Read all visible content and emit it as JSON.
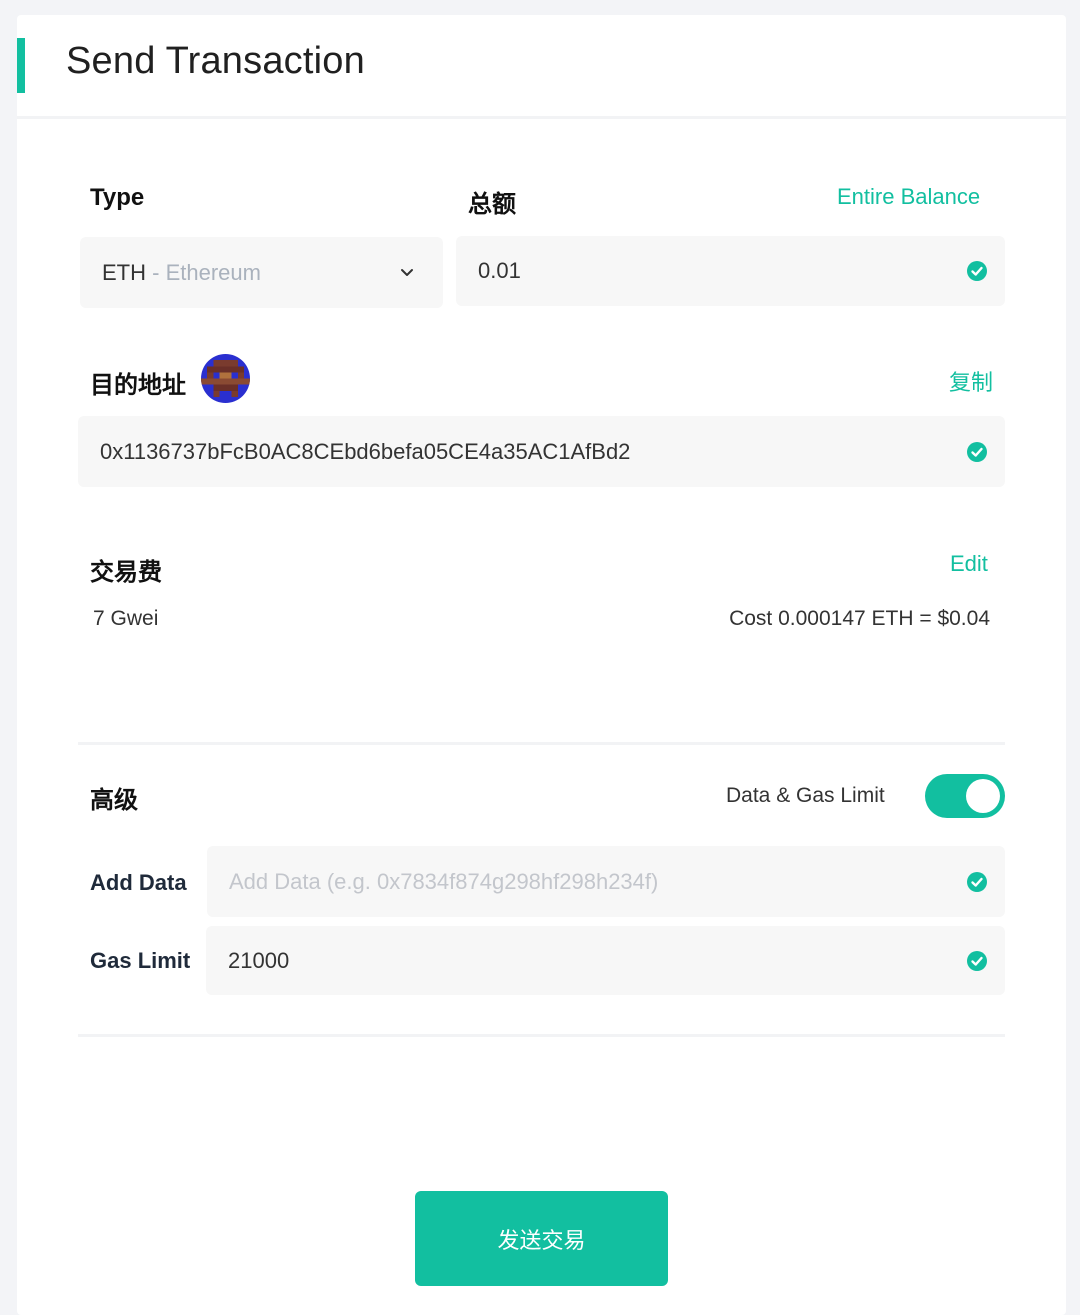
{
  "header": {
    "title": "Send Transaction"
  },
  "type": {
    "label": "Type",
    "selected_symbol": "ETH",
    "selected_name": "- Ethereum"
  },
  "amount": {
    "label": "总额",
    "entire_balance_link": "Entire Balance",
    "value": "0.01"
  },
  "address": {
    "label": "目的地址",
    "copy_link": "复制",
    "value": "0x1136737bFcB0AC8CEbd6befa05CE4a35AC1AfBd2"
  },
  "fee": {
    "label": "交易费",
    "edit_link": "Edit",
    "gas_price": "7 Gwei",
    "cost": "Cost 0.000147 ETH = $0.04"
  },
  "advanced": {
    "label": "高级",
    "toggle_label": "Data & Gas Limit",
    "toggle_on": true,
    "add_data_label": "Add Data",
    "add_data_placeholder": "Add Data (e.g. 0x7834f874g298hf298h234f)",
    "gas_limit_label": "Gas Limit",
    "gas_limit_value": "21000"
  },
  "send_button": {
    "label": "发送交易"
  },
  "colors": {
    "accent": "#12bfa0",
    "field_bg": "#f7f7f7",
    "page_bg": "#f3f4f7"
  },
  "icons": [
    "check-icon",
    "chevron-down-icon",
    "identicon-avatar"
  ]
}
